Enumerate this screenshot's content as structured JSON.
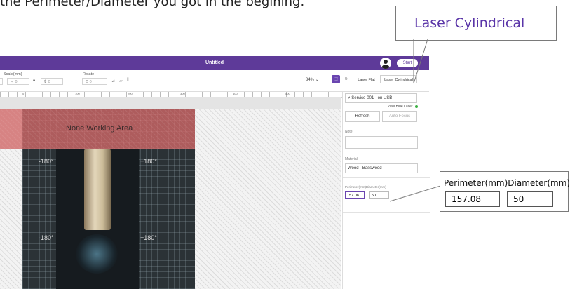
{
  "instruction_text": "the Perimeter/Diameter you got in the begining.",
  "callouts": {
    "laser_cylindrical": "Laser Cylindrical",
    "perimeter_label": "Perimeter(mm)Diameter(mm)",
    "perimeter_value": "157.08",
    "diameter_value": "50"
  },
  "app": {
    "title": "Untitled",
    "start_label": "Start",
    "toolbar": {
      "scale_label": "Scale(mm)",
      "scale_w": "0",
      "scale_h": "0",
      "rotate_label": "Rotate",
      "rotate_value": "0",
      "zoom": "84%",
      "tab_flat": "Laser Flat",
      "tab_cylindrical": "Laser Cylindrical"
    },
    "ruler_ticks": [
      "0",
      "100",
      "200",
      "300",
      "400",
      "500"
    ],
    "canvas": {
      "none_working_area": "None Working Area",
      "deg_left_top": "-180°",
      "deg_right_top": "+180°",
      "deg_left_bottom": "-180°",
      "deg_right_bottom": "+180°"
    },
    "panel": {
      "device": "Service-001 - on USB",
      "laser_type": "20W Blue Laser",
      "refresh": "Refresh",
      "auto_focus": "Auto Focus",
      "note_label": "Note",
      "material_label": "Material",
      "material_value": "Wood - Basswood",
      "perimeter_label": "Perimeter(mm)Diameter(mm)",
      "perimeter_value": "157.08",
      "diameter_value": "50"
    }
  },
  "colors": {
    "accent": "#5e3a99",
    "status_green": "#3cb043",
    "no_work_red": "#d46868"
  }
}
